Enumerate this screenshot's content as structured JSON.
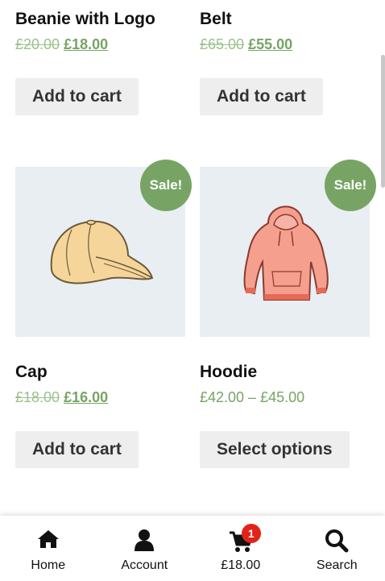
{
  "products": [
    {
      "title": "Beanie with Logo",
      "price_old": "£20.00",
      "price_new": "£18.00",
      "button": "Add to cart"
    },
    {
      "title": "Belt",
      "price_old": "£65.00",
      "price_new": "£55.00",
      "button": "Add to cart"
    },
    {
      "title": "Cap",
      "price_old": "£18.00",
      "price_new": "£16.00",
      "button": "Add to cart",
      "badge": "Sale!",
      "image_icon": "cap-image"
    },
    {
      "title": "Hoodie",
      "price_range": "£42.00 – £45.00",
      "button": "Select options",
      "badge": "Sale!",
      "image_icon": "hoodie-image"
    }
  ],
  "bottom_nav": {
    "home": {
      "label": "Home",
      "icon": "home-icon"
    },
    "account": {
      "label": "Account",
      "icon": "user-icon"
    },
    "cart": {
      "label": "£18.00",
      "icon": "cart-icon",
      "count": "1"
    },
    "search": {
      "label": "Search",
      "icon": "search-icon"
    }
  },
  "colors": {
    "accent": "#77a464",
    "button_bg": "#eeeeee",
    "badge_red": "#e2231a",
    "thumb_bg": "#e9eef2"
  }
}
